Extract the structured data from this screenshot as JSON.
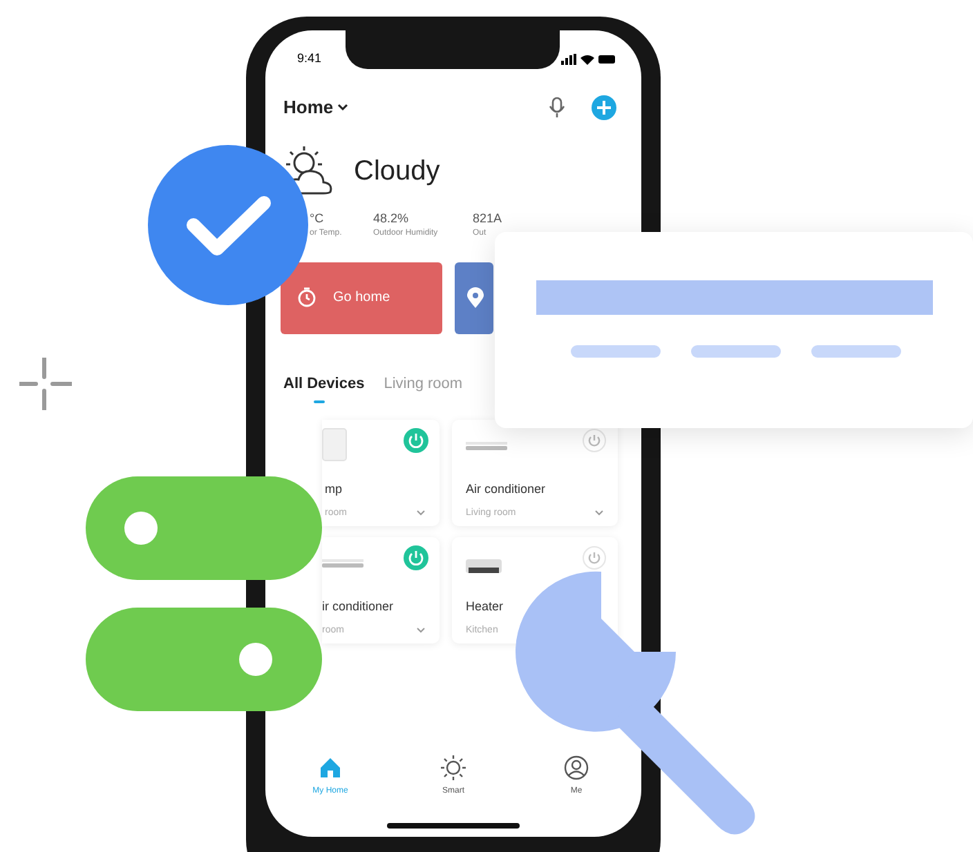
{
  "status_bar": {
    "time": "9:41"
  },
  "header": {
    "title": "Home"
  },
  "weather": {
    "condition": "Cloudy",
    "stats": [
      {
        "value": "°C",
        "label": "or Temp."
      },
      {
        "value": "48.2%",
        "label": "Outdoor Humidity"
      },
      {
        "value": "821A",
        "label": "Out"
      }
    ]
  },
  "scenes": [
    {
      "kind": "timer",
      "label": "Go home",
      "color": "#de6262"
    },
    {
      "kind": "location",
      "color": "#5d80c6"
    }
  ],
  "tabs": [
    {
      "label": "All Devices",
      "selected": true
    },
    {
      "label": "Living room",
      "selected": false
    }
  ],
  "devices": [
    {
      "kind": "lamp",
      "name": "mp",
      "room": "room",
      "on": true
    },
    {
      "kind": "ac",
      "name": "Air conditioner",
      "room": "Living room",
      "on": false
    },
    {
      "kind": "ac",
      "name": "ir conditioner",
      "room": "room",
      "on": true
    },
    {
      "kind": "heater",
      "name": "Heater",
      "room": "Kitchen",
      "on": false
    }
  ],
  "nav": [
    {
      "kind": "home",
      "label": "My Home",
      "selected": true
    },
    {
      "kind": "sun",
      "label": "Smart",
      "selected": false
    },
    {
      "kind": "person",
      "label": "Me",
      "selected": false
    }
  ],
  "toggles": [
    {
      "on": false
    },
    {
      "on": true
    }
  ]
}
